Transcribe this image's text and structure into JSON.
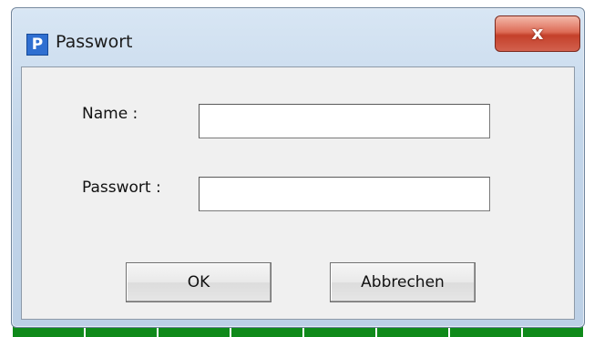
{
  "window": {
    "title": "Passwort",
    "app_icon_glyph": "P",
    "close_glyph": "x"
  },
  "form": {
    "name_label": "Name :",
    "name_value": "",
    "password_label": "Passwort :",
    "password_value": ""
  },
  "buttons": {
    "ok_label": "OK",
    "cancel_label": "Abbrechen"
  },
  "colors": {
    "title_icon": "#2f6fd1",
    "close_button": "#c4402a",
    "background_strip": "#0f8a1a"
  }
}
